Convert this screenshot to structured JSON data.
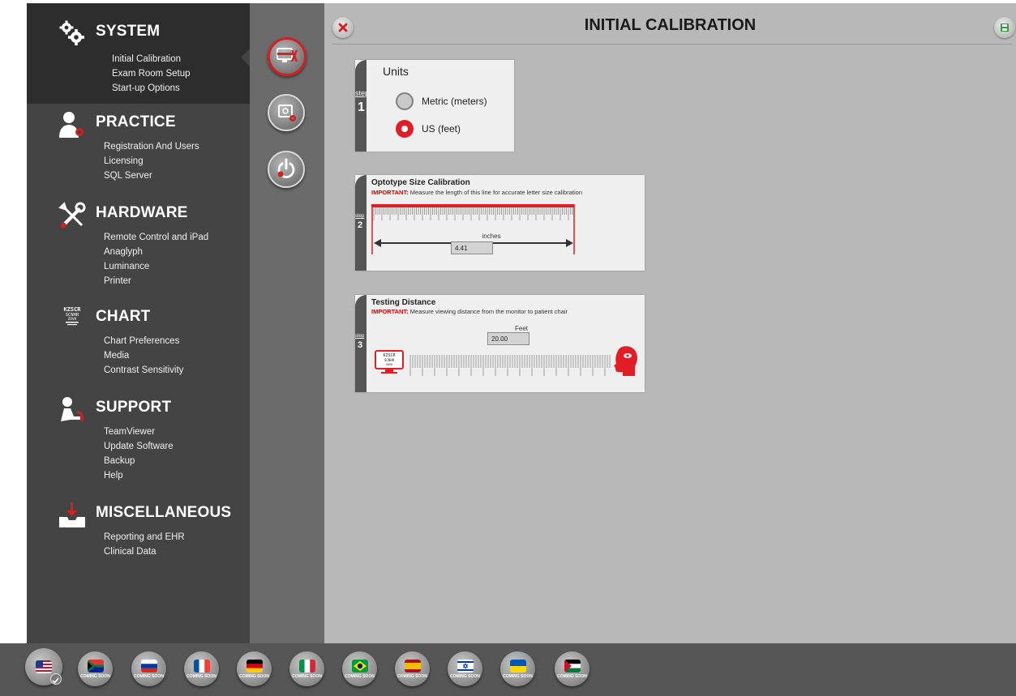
{
  "sidebar": {
    "sections": [
      {
        "title": "SYSTEM",
        "icon": "gears-icon",
        "items": [
          "Initial Calibration",
          "Exam Room Setup",
          "Start-up Options"
        ]
      },
      {
        "title": "PRACTICE",
        "icon": "user-gear-icon",
        "items": [
          "Registration And Users",
          "Licensing",
          "SQL Server"
        ]
      },
      {
        "title": "HARDWARE",
        "icon": "tools-icon",
        "items": [
          "Remote Control and iPad",
          "Anaglyph",
          "Luminance",
          "Printer"
        ]
      },
      {
        "title": "CHART",
        "icon": "eye-chart-icon",
        "items": [
          "Chart Preferences",
          "Media",
          "Contrast Sensitivity"
        ]
      },
      {
        "title": "SUPPORT",
        "icon": "support-icon",
        "items": [
          "TeamViewer",
          "Update Software",
          "Backup",
          "Help"
        ]
      },
      {
        "title": "MISCELLANEOUS",
        "icon": "download-tray-icon",
        "items": [
          "Reporting and EHR",
          "Clinical Data"
        ]
      }
    ]
  },
  "header": {
    "title": "INITIAL CALIBRATION"
  },
  "step1": {
    "step_word": "step",
    "step_num": "1",
    "title": "Units",
    "options": [
      {
        "label": "Metric (meters)",
        "selected": false
      },
      {
        "label": "US (feet)",
        "selected": true
      }
    ]
  },
  "step2": {
    "step_word": "step",
    "step_num": "2",
    "title": "Optotype Size Calibration",
    "important_prefix": "IMPORTANT:",
    "important_text": "Measure the length of this line for accurate letter size calibration",
    "unit_label": "inches",
    "value": "4.41"
  },
  "step3": {
    "step_word": "step",
    "step_num": "3",
    "title": "Testing Distance",
    "important_prefix": "IMPORTANT:",
    "important_text": "Measure viewing distance from the monitor to patient chair",
    "unit_label": "Feet",
    "value": "20.00",
    "chart_letters": [
      "KZSCR",
      "SCNHR",
      "ZOVK"
    ]
  },
  "footer": {
    "coming_soon": "COMING SOON",
    "flags": [
      {
        "name": "flag-us",
        "label": ""
      },
      {
        "name": "flag-south-africa",
        "label": "COMING SOON"
      },
      {
        "name": "flag-russia",
        "label": "COMING SOON"
      },
      {
        "name": "flag-france",
        "label": "COMING SOON"
      },
      {
        "name": "flag-germany",
        "label": "COMING SOON"
      },
      {
        "name": "flag-italy",
        "label": "COMING SOON"
      },
      {
        "name": "flag-brazil",
        "label": "COMING SOON"
      },
      {
        "name": "flag-spain",
        "label": "COMING SOON"
      },
      {
        "name": "flag-israel",
        "label": "COMING SOON"
      },
      {
        "name": "flag-ukraine",
        "label": "COMING SOON"
      },
      {
        "name": "flag-palestine",
        "label": "COMING SOON"
      }
    ]
  },
  "colors": {
    "accent": "#e11e26",
    "sidebar": "#444444",
    "main": "#b8b8b8"
  }
}
